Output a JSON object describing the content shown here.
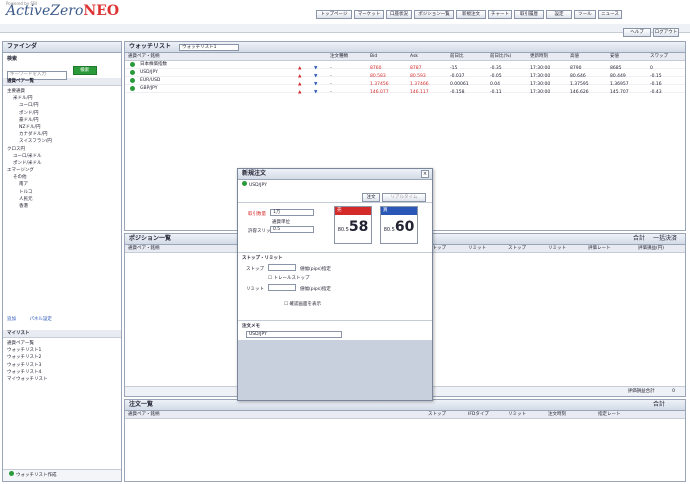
{
  "app": {
    "logo_main": "ActiveZero",
    "logo_accent": "NEO",
    "tagline": "Powered by SBI"
  },
  "toolbar": {
    "buttons": [
      "トップページ",
      "マーケット",
      "口座状況",
      "ポジション一覧",
      "新規注文",
      "チャート",
      "取引履歴",
      "設定",
      "ツール",
      "ニュース"
    ],
    "right_buttons": [
      "ヘルプ",
      "ログアウト"
    ]
  },
  "finder": {
    "title": "ファインダ",
    "section": "検索",
    "search_placeholder": "キーワードを入力",
    "search_button": "検索",
    "list_title": "通貨ペア一覧",
    "tree": [
      "主要通貨",
      "米ドル/円",
      "ユーロ/円",
      "ポンド/円",
      "豪ドル/円",
      "NZドル/円",
      "カナダドル/円",
      "スイスフラン/円",
      "クロス円",
      "ユーロ/米ドル",
      "ポンド/米ドル",
      "エマージング",
      "その他",
      "南ア",
      "トルコ",
      "人民元",
      "香港"
    ],
    "link1": "追加",
    "link2": "パネル設定",
    "sub_title": "マイリスト",
    "sub_items": [
      "通貨ペア一覧",
      "ウォッチリスト1",
      "ウォッチリスト2",
      "ウォッチリスト3",
      "ウォッチリスト4",
      "マイウォッチリスト"
    ],
    "footer": "ウォッチリスト作成"
  },
  "watchlist": {
    "title": "ウォッチリスト",
    "list_select": "ウォッチリスト1",
    "columns": [
      "通貨ペア・銘柄",
      "",
      "",
      "注文種類",
      "Bid",
      "Ask",
      "前日比",
      "前日比(%)",
      "更新時刻",
      "高値",
      "安値",
      "スワップ"
    ],
    "rows": [
      {
        "name": "日本株価指数",
        "v": [
          "-",
          "8760",
          "8787",
          "-15",
          "-0.35",
          "17:30:00",
          "8790",
          "8685",
          "0"
        ]
      },
      {
        "name": "USD/JPY",
        "v": [
          "-",
          "80.583",
          "80.593",
          "-0.037",
          "-0.05",
          "17:30:00",
          "80.646",
          "80.449",
          "-0.15"
        ]
      },
      {
        "name": "EUR/USD",
        "v": [
          "-",
          "1.37456",
          "1.37466",
          "0.00061",
          "0.04",
          "17:30:00",
          "1.37595",
          "1.36957",
          "-0.16"
        ]
      },
      {
        "name": "GBP/JPY",
        "v": [
          "-",
          "146.077",
          "146.117",
          "-0.158",
          "-0.11",
          "17:30:00",
          "146.626",
          "145.707",
          "-0.43"
        ]
      }
    ]
  },
  "order_dialog": {
    "title": "新規注文",
    "pair": "USD/JPY",
    "tab1": "注文",
    "tab2": "リアルタイム",
    "qty_label": "取引数量",
    "qty_value": "1万",
    "qty_unit": "通貨単位",
    "slip_label": "許容スリップ",
    "slip_value": "0.5",
    "sell_label": "売",
    "buy_label": "買",
    "sell_price": "58",
    "buy_price": "60",
    "price_prefix": "80.5",
    "stop_section": "ストップ・リミット",
    "stop_label": "ストップ",
    "limit_label": "リミット",
    "stop_check": "トレールストップ",
    "pips_label": "値幅(pips)指定",
    "pips_label2": "値幅(pips)指定",
    "confirm_check": "確認画面を表示",
    "memo_section": "注文メモ",
    "memo_value": "USD/JPY"
  },
  "positions": {
    "title": "ポジション一覧",
    "summary_label": "合計",
    "select_all": "一括決済",
    "columns": [
      "通貨ペア・銘柄",
      "ストップ",
      "リミット",
      "ストップ",
      "リミット",
      "評価レート",
      "評価損益(円)"
    ],
    "footer_label": "評価損益合計",
    "footer_value": "0"
  },
  "orders": {
    "title": "注文一覧",
    "summary_label": "合計",
    "columns": [
      "通貨ペア・銘柄",
      "ストップ",
      "IFDタイプ",
      "リミット",
      "注文時刻",
      "指定レート"
    ]
  },
  "colors": {
    "sell": "#d42a2a",
    "buy": "#2a56b8",
    "accent": "#2a9a3a"
  }
}
